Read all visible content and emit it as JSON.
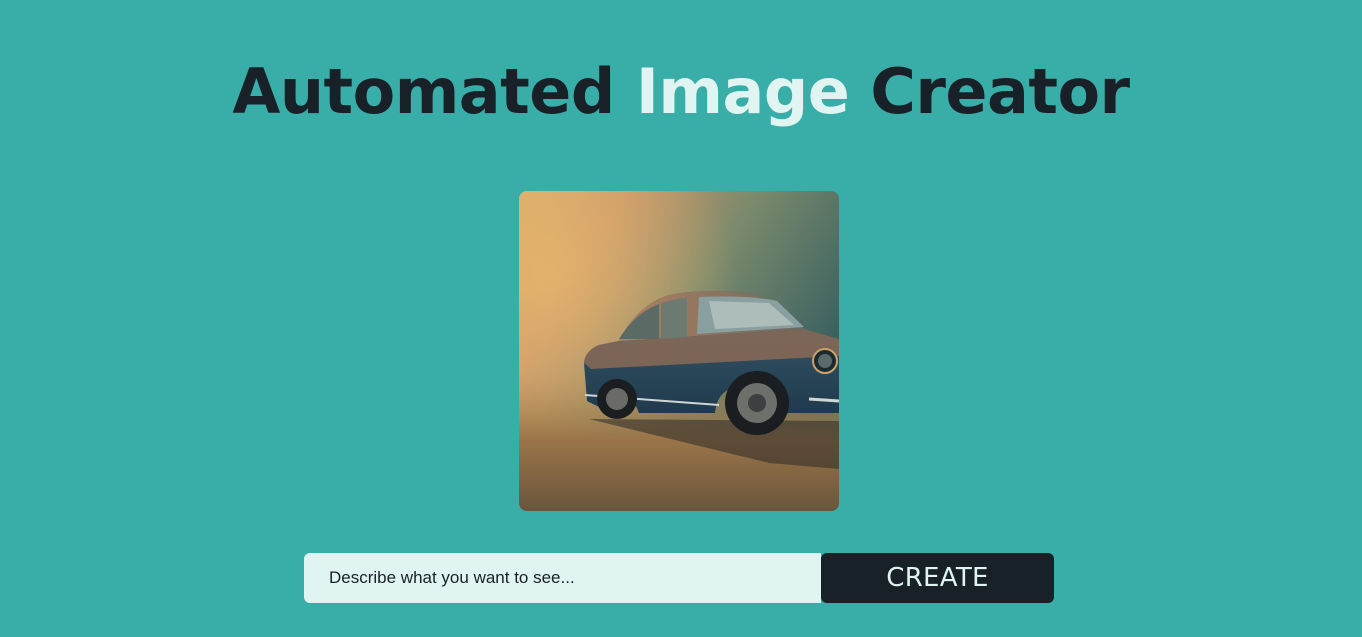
{
  "header": {
    "title_part1": "Automated",
    "title_part2": "Image",
    "title_part3": "Creator"
  },
  "generated_image": {
    "subject": "vintage-car-illustration"
  },
  "form": {
    "placeholder": "Describe what you want to see...",
    "submit_label": "CREATE"
  },
  "colors": {
    "background": "#39aea9",
    "dark": "#182127",
    "light": "#e0f4f1"
  }
}
